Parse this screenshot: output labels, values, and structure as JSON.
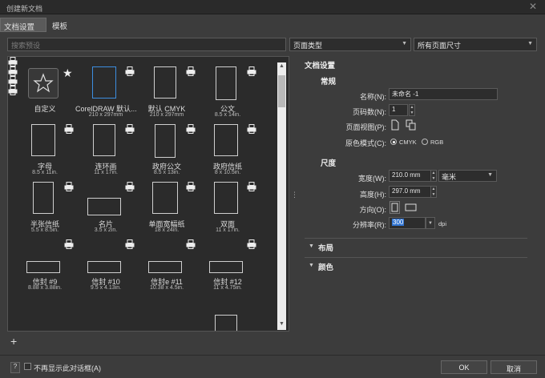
{
  "window": {
    "title": "创建新文档",
    "close_glyph": "✕"
  },
  "tabs": [
    {
      "label": "文档设置"
    },
    {
      "label": "模板"
    }
  ],
  "filter": {
    "search_placeholder": "搜索预设",
    "page_type": "页面类型",
    "page_size": "所有页面尺寸"
  },
  "presets": [
    {
      "name": "自定义",
      "size": "",
      "kind": "custom"
    },
    {
      "name": "CorelDRAW 默认...",
      "size": "210 x 297mm",
      "kind": "page"
    },
    {
      "name": "默认 CMYK",
      "size": "210 x 297mm",
      "kind": "page"
    },
    {
      "name": "公文",
      "size": "8.5 x 14in.",
      "kind": "page"
    },
    {
      "name": "字母",
      "size": "8.5 x 11in.",
      "kind": "page"
    },
    {
      "name": "连环画",
      "size": "11 x 17in.",
      "kind": "page"
    },
    {
      "name": "政府公文",
      "size": "8.5 x 13in.",
      "kind": "page"
    },
    {
      "name": "政府信纸",
      "size": "8 x 10.5in.",
      "kind": "page"
    },
    {
      "name": "半张信纸",
      "size": "5.5 x 8.5in.",
      "kind": "page"
    },
    {
      "name": "名片",
      "size": "3.5 x 2in.",
      "kind": "page"
    },
    {
      "name": "单面宽幅纸",
      "size": "18 x 24in.",
      "kind": "page"
    },
    {
      "name": "双面",
      "size": "11 x 17in.",
      "kind": "page"
    },
    {
      "name": "信封 #9",
      "size": "8.88 x 3.88in.",
      "kind": "page"
    },
    {
      "name": "信封 #10",
      "size": "9.5 x 4.13in.",
      "kind": "page"
    },
    {
      "name": "信封e #11",
      "size": "10.38 x 4.5in.",
      "kind": "page"
    },
    {
      "name": "信封 #12",
      "size": "11 x 4.75in.",
      "kind": "page"
    }
  ],
  "settings": {
    "title": "文档设置",
    "general_title": "常规",
    "name_label": "名称(N):",
    "name_value": "未命名 -1",
    "pages_label": "页码数(N):",
    "pages_value": "1",
    "view_label": "页面视图(P):",
    "color_mode_label": "原色模式(C):",
    "cmyk": "CMYK",
    "rgb": "RGB",
    "size_title": "尺度",
    "width_label": "宽度(W):",
    "width_value": "210.0 mm",
    "unit_value": "毫米",
    "height_label": "高度(H):",
    "height_value": "297.0 mm",
    "orientation_label": "方向(O):",
    "resolution_label": "分辨率(R):",
    "resolution_value": "300",
    "dpi": "dpi",
    "layout": "布局",
    "color": "颜色"
  },
  "footer": {
    "help": "?",
    "dont_show": "不再显示此对话框(A)",
    "ok": "OK",
    "cancel": "取消"
  }
}
